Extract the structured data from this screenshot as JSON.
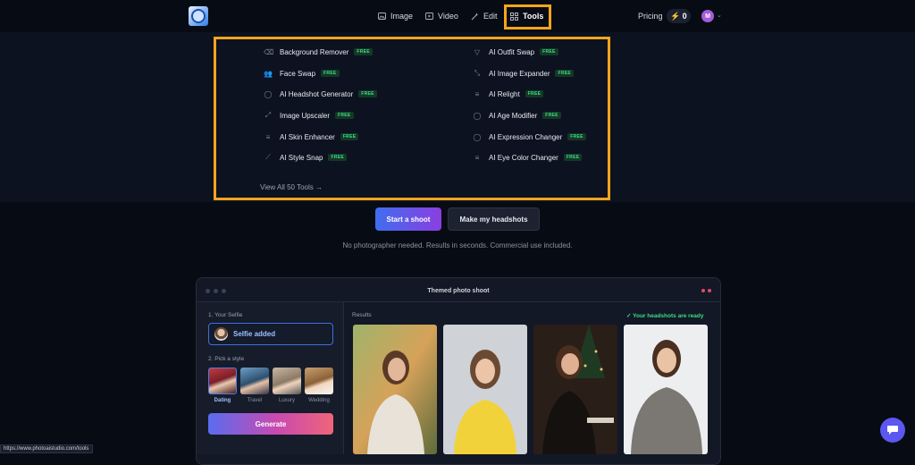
{
  "nav": {
    "items": [
      {
        "label": "Image",
        "icon": "image-icon"
      },
      {
        "label": "Video",
        "icon": "video-icon"
      },
      {
        "label": "Edit",
        "icon": "magic-wand-icon"
      },
      {
        "label": "Tools",
        "icon": "grid-icon"
      }
    ],
    "pricing": "Pricing",
    "credits": "0",
    "avatar_initial": "M"
  },
  "tools_menu": {
    "left": [
      {
        "label": "Background Remover",
        "badge": "FREE",
        "icon": "eraser-icon"
      },
      {
        "label": "Face Swap",
        "badge": "FREE",
        "icon": "users-icon"
      },
      {
        "label": "AI Headshot Generator",
        "badge": "FREE",
        "icon": "user-icon"
      },
      {
        "label": "Image Upscaler",
        "badge": "FREE",
        "icon": "expand-icon"
      },
      {
        "label": "AI Skin Enhancer",
        "badge": "FREE",
        "icon": "sliders-icon"
      },
      {
        "label": "AI Style Snap",
        "badge": "FREE",
        "icon": "wand-icon"
      }
    ],
    "right": [
      {
        "label": "AI Outfit Swap",
        "badge": "FREE",
        "icon": "shirt-icon"
      },
      {
        "label": "AI Image Expander",
        "badge": "FREE",
        "icon": "arrows-expand-icon"
      },
      {
        "label": "AI Relight",
        "badge": "FREE",
        "icon": "sliders-icon"
      },
      {
        "label": "AI Age Modifier",
        "badge": "FREE",
        "icon": "user-icon"
      },
      {
        "label": "AI Expression Changer",
        "badge": "FREE",
        "icon": "user-icon"
      },
      {
        "label": "AI Eye Color Changer",
        "badge": "FREE",
        "icon": "sliders-icon"
      }
    ],
    "view_all": "View All 50 Tools →"
  },
  "hero": {
    "primary_button": "Start a shoot",
    "secondary_button": "Make my headshots",
    "subtext": "No photographer needed. Results in seconds. Commercial use included."
  },
  "demo": {
    "title": "Themed photo shoot",
    "step1_label": "1. Your Selfie",
    "selfie_status": "Selfie added",
    "step2_label": "2. Pick a style",
    "styles": [
      "Dating",
      "Travel",
      "Luxury",
      "Wedding"
    ],
    "selected_style": "Dating",
    "generate_button": "Generate",
    "results_label": "Results",
    "ready_text": "✓  Your headshots are ready"
  },
  "status_bar": "https://www.photoaistudio.com/tools",
  "colors": {
    "accent_highlight": "#f7a51c",
    "free_badge": "#3ddc84",
    "primary_gradient_start": "#3f6ef0",
    "primary_gradient_end": "#8b3ee0"
  }
}
